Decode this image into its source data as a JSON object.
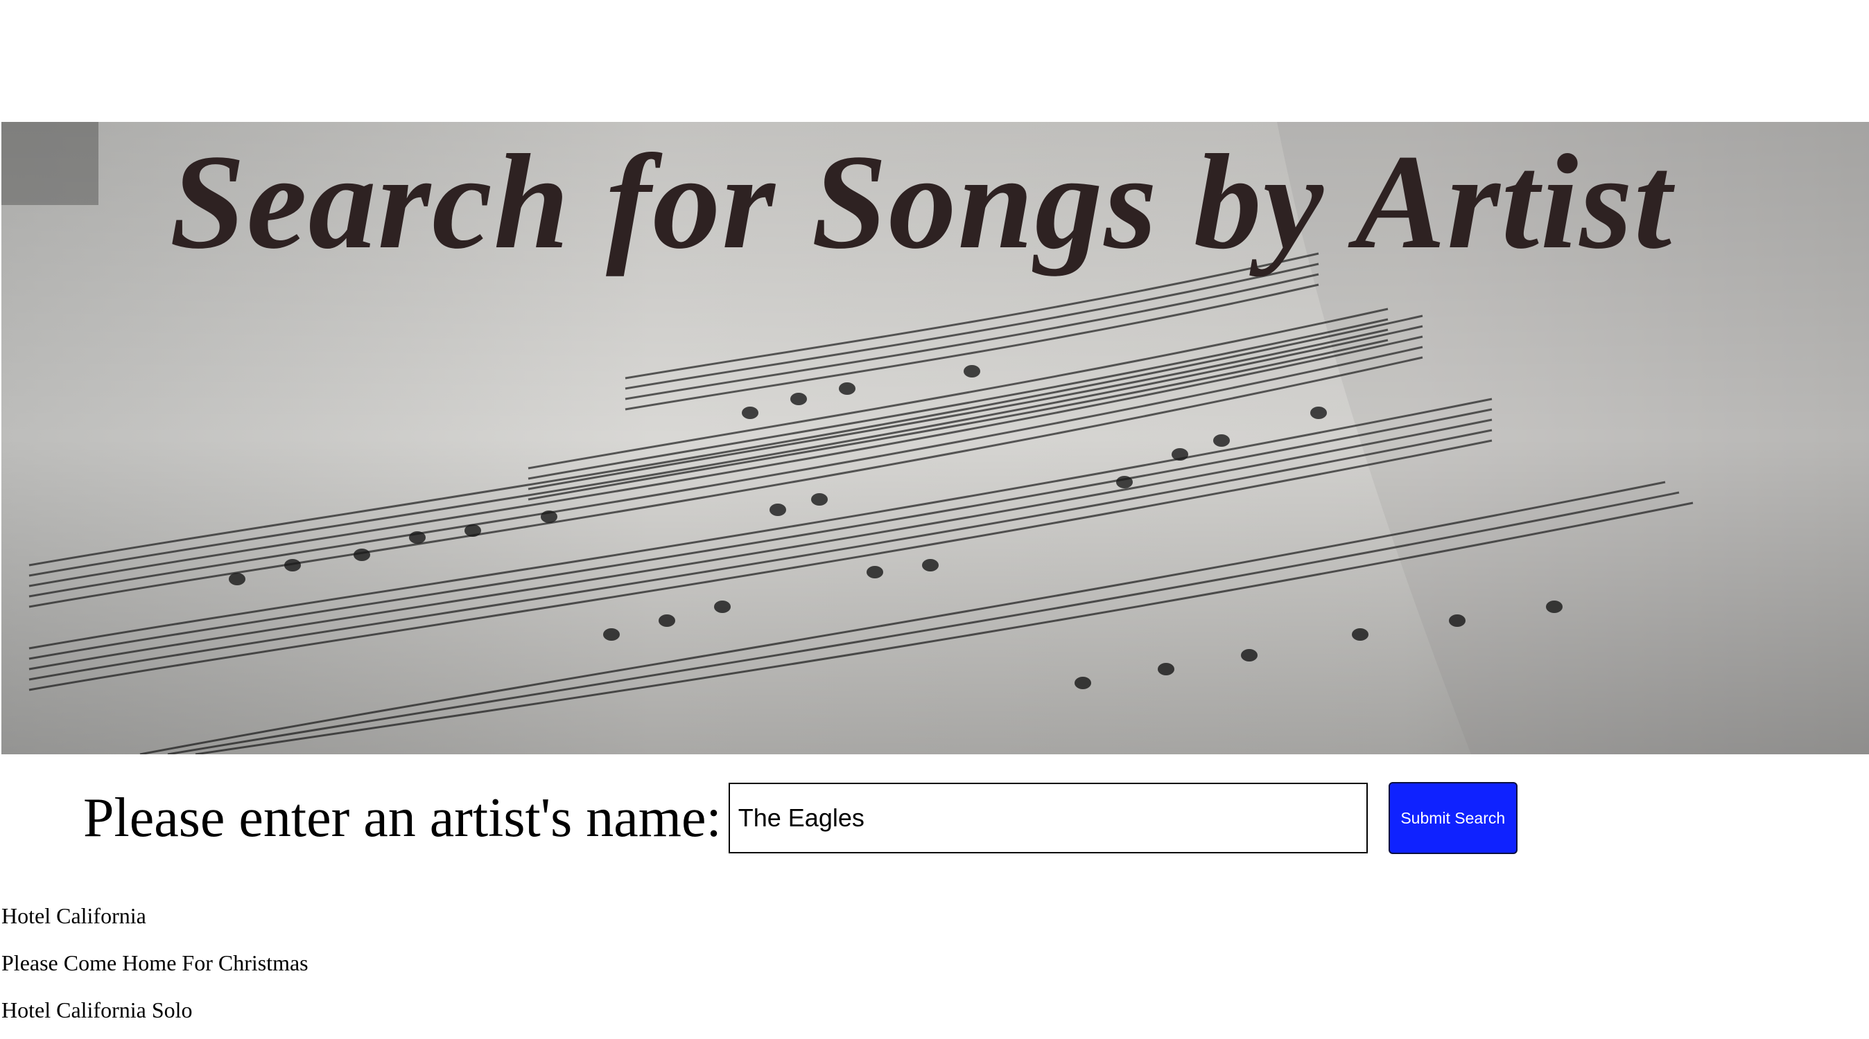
{
  "banner": {
    "title": "Search for Songs by Artist",
    "image": "sheet-music-photo"
  },
  "search": {
    "label": "Please enter an artist's name:",
    "value": "The Eagles",
    "placeholder": "",
    "button_label": "Submit Search",
    "button_color": "#0f22ff"
  },
  "results": [
    "Hotel California",
    "Please Come Home For Christmas",
    "Hotel California Solo"
  ],
  "colors": {
    "title_text": "#2e2222",
    "background": "#ffffff"
  }
}
